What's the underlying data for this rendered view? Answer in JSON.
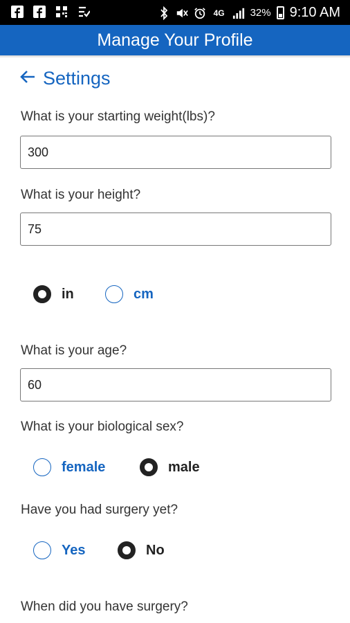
{
  "status_bar": {
    "time": "9:10 AM",
    "battery": "32%",
    "icons": [
      "facebook-icon",
      "facebook-icon",
      "qr-app-icon",
      "tasks-app-icon",
      "bluetooth-icon",
      "mute-icon",
      "alarm-icon",
      "4g-lte-icon",
      "signal-icon",
      "battery-icon"
    ]
  },
  "app_bar": {
    "title": "Manage Your Profile",
    "color": "#1565c0"
  },
  "back_link": {
    "label": "Settings",
    "icon": "arrow-left-icon"
  },
  "form": {
    "weight": {
      "label": "What is your starting weight(lbs)?",
      "value": "300"
    },
    "height": {
      "label": "What is your height?",
      "value": "75"
    },
    "height_unit": {
      "options": [
        "in",
        "cm"
      ],
      "selected": "in"
    },
    "age": {
      "label": "What is your age?",
      "value": "60"
    },
    "sex": {
      "label": "What is your biological sex?",
      "options": [
        "female",
        "male"
      ],
      "selected": "male"
    },
    "surgery": {
      "label": "Have you had surgery yet?",
      "options": [
        "Yes",
        "No"
      ],
      "selected": "No"
    },
    "surgery_date": {
      "label": "When did you have surgery?"
    }
  }
}
